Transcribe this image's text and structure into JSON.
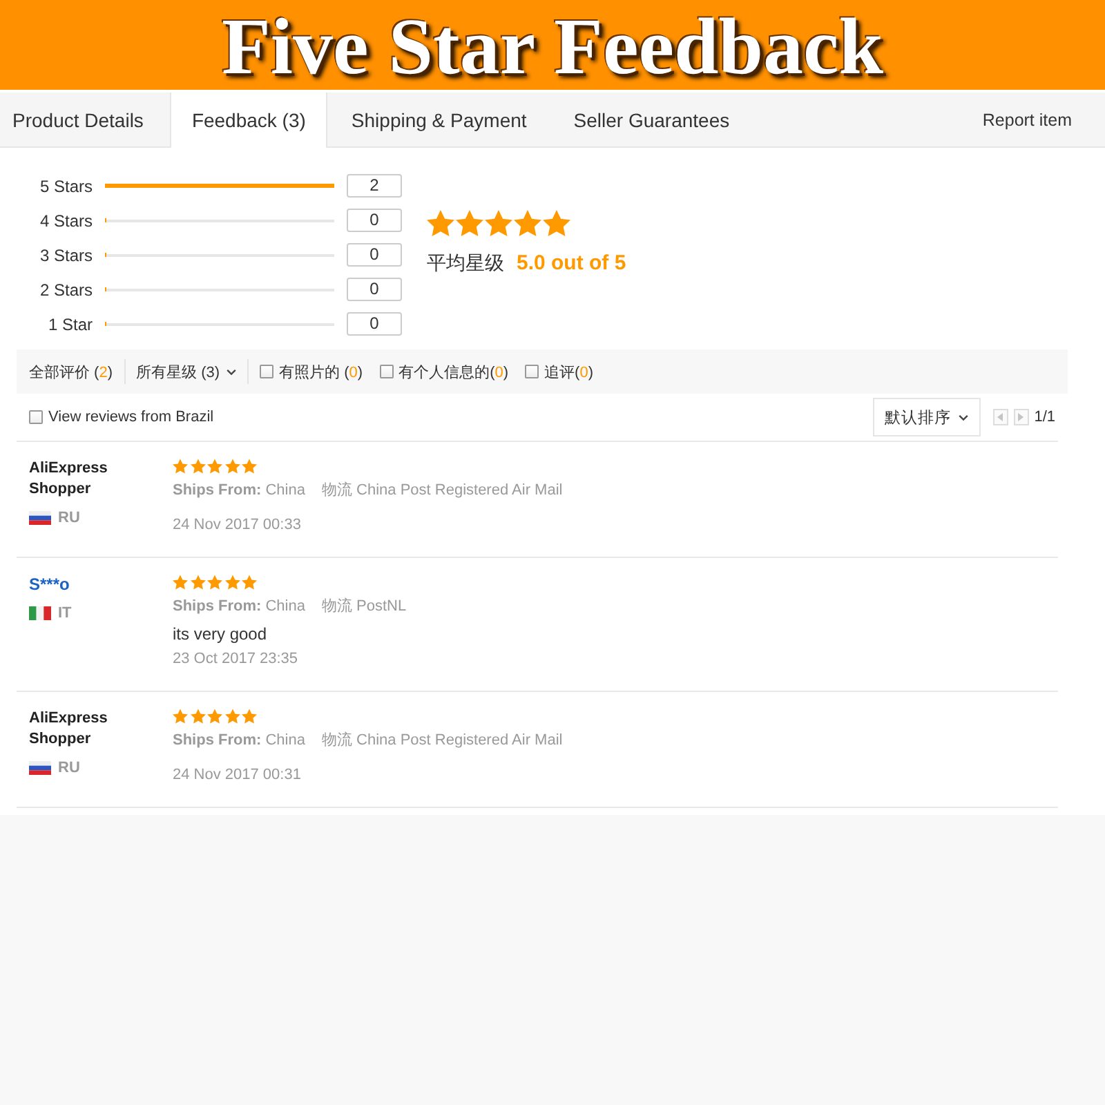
{
  "banner": {
    "title": "Five Star Feedback"
  },
  "tabs": [
    {
      "label": "Product Details",
      "selected": false
    },
    {
      "label": "Feedback (3)",
      "selected": true
    },
    {
      "label": "Shipping & Payment",
      "selected": false
    },
    {
      "label": "Seller Guarantees",
      "selected": false
    }
  ],
  "report_link": "Report item",
  "rating_breakdown": [
    {
      "label": "5 Stars",
      "level": 1,
      "count": "2"
    },
    {
      "label": "4 Stars",
      "level": 0,
      "count": "0"
    },
    {
      "label": "3 Stars",
      "level": 0,
      "count": "0"
    },
    {
      "label": "2 Stars",
      "level": 0,
      "count": "0"
    },
    {
      "label": "1 Star",
      "level": 0,
      "count": "0"
    }
  ],
  "average": {
    "stars": 5,
    "label": "平均星级",
    "value": "5.0 out of 5"
  },
  "filters": [
    {
      "kind": "link",
      "label": "全部评价 (",
      "count": "2",
      "close": ")"
    },
    {
      "kind": "dropdown",
      "label": "所有星级 (3)"
    },
    {
      "kind": "checkbox",
      "label": "有照片的 (",
      "count": "0",
      "close": ")",
      "checked": false
    },
    {
      "kind": "checkbox",
      "label": "有个人信息的(",
      "count": "0",
      "close": ")",
      "checked": false
    },
    {
      "kind": "checkbox",
      "label": "追评(",
      "count": "0",
      "close": ")",
      "checked": false
    }
  ],
  "region_filter": {
    "label": "View reviews from Brazil",
    "checked": false
  },
  "sort": {
    "label": "默认排序"
  },
  "pager": {
    "prev": {
      "disabled": true
    },
    "next": {
      "disabled": true
    },
    "page": "1/1"
  },
  "reviews": [
    {
      "name": "AliExpress Shopper",
      "linked": false,
      "flag": {
        "kind": "horizontal"
      },
      "country": "RU",
      "stars": 5,
      "ships_from": "**Ships From:** China",
      "logistics": "物流 China Post Registered Air Mail",
      "date": "24 Nov 2017 00:33"
    },
    {
      "name": "S***o",
      "linked": true,
      "flag": {
        "kind": "vertical"
      },
      "country": "IT",
      "stars": 5,
      "ships_from": "**Ships From:** China",
      "logistics": "物流 PostNL",
      "comment": "its very good",
      "date": "23 Oct 2017 23:35"
    },
    {
      "name": "AliExpress Shopper",
      "linked": false,
      "flag": {
        "kind": "horizontal"
      },
      "country": "RU",
      "stars": 5,
      "ships_from": "**Ships From:** China",
      "logistics": "物流 China Post Registered Air Mail",
      "date": "24 Nov 2017 00:31"
    }
  ]
}
